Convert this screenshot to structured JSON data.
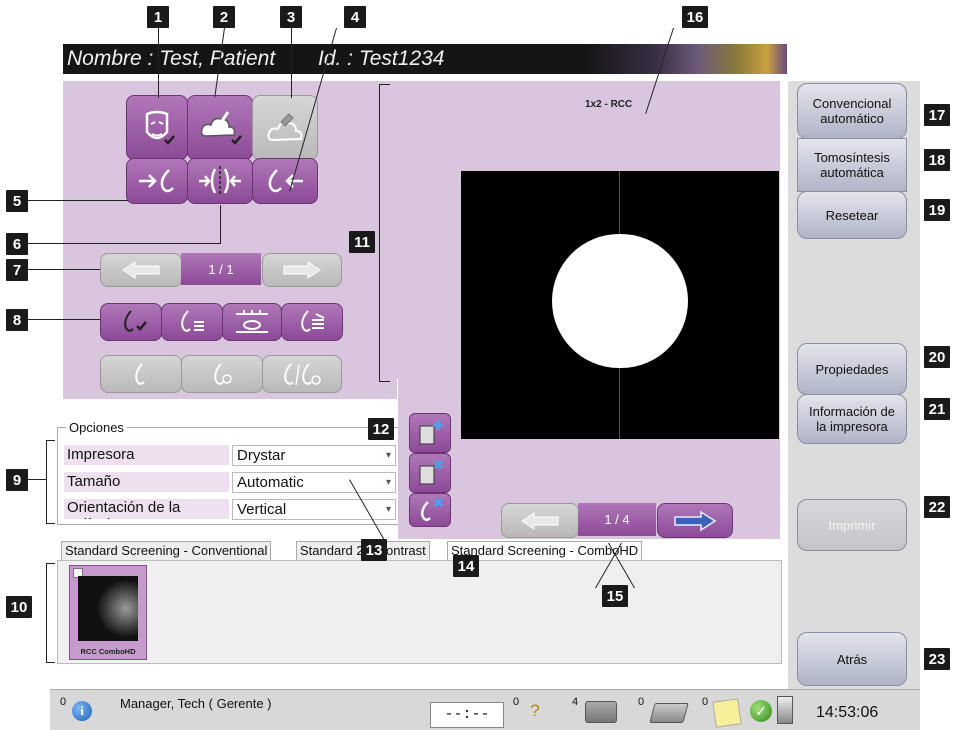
{
  "header": {
    "patient_label": "Nombre : Test, Patient",
    "id_label": "Id. : Test1234"
  },
  "callouts": [
    "1",
    "2",
    "3",
    "4",
    "5",
    "6",
    "7",
    "8",
    "9",
    "10",
    "11",
    "12",
    "13",
    "14",
    "15",
    "16",
    "17",
    "18",
    "19",
    "20",
    "21",
    "22",
    "23"
  ],
  "tools": {
    "view_pager": "1 / 1"
  },
  "options": {
    "title": "Opciones",
    "rows": [
      {
        "label": "Impresora",
        "value": "Drystar"
      },
      {
        "label": "Tamaño",
        "value": "Automatic"
      },
      {
        "label": "Orientación de la película",
        "value": "Vertical"
      }
    ]
  },
  "preview": {
    "title": "1x2 - RCC",
    "pager": "1 / 4"
  },
  "tabs": [
    "Standard Screening - Conventional",
    "Standard 2D Contrast",
    "Standard Screening - ComboHD"
  ],
  "thumbnail_label": "RCC ComboHD",
  "right_panel": {
    "conventional": "Convencional automático",
    "tomo": "Tomosíntesis automática",
    "reset": "Resetear",
    "properties": "Propiedades",
    "printer_info": "Información de la impresora",
    "print": "Imprimir",
    "back": "Atrás"
  },
  "statusbar": {
    "count_info": "0",
    "user": "Manager, Tech ( Gerente )",
    "timer": "--:--",
    "count_help": "0",
    "count_images": "4",
    "count_print": "0",
    "count_notes": "0",
    "clock": "14:53:06"
  },
  "colors": {
    "accent_purple": "#8c4a97",
    "panel_lilac": "#d9c5dd",
    "selected_yellow": "#f2ea1c",
    "nav_blue": "#3a62b8"
  }
}
